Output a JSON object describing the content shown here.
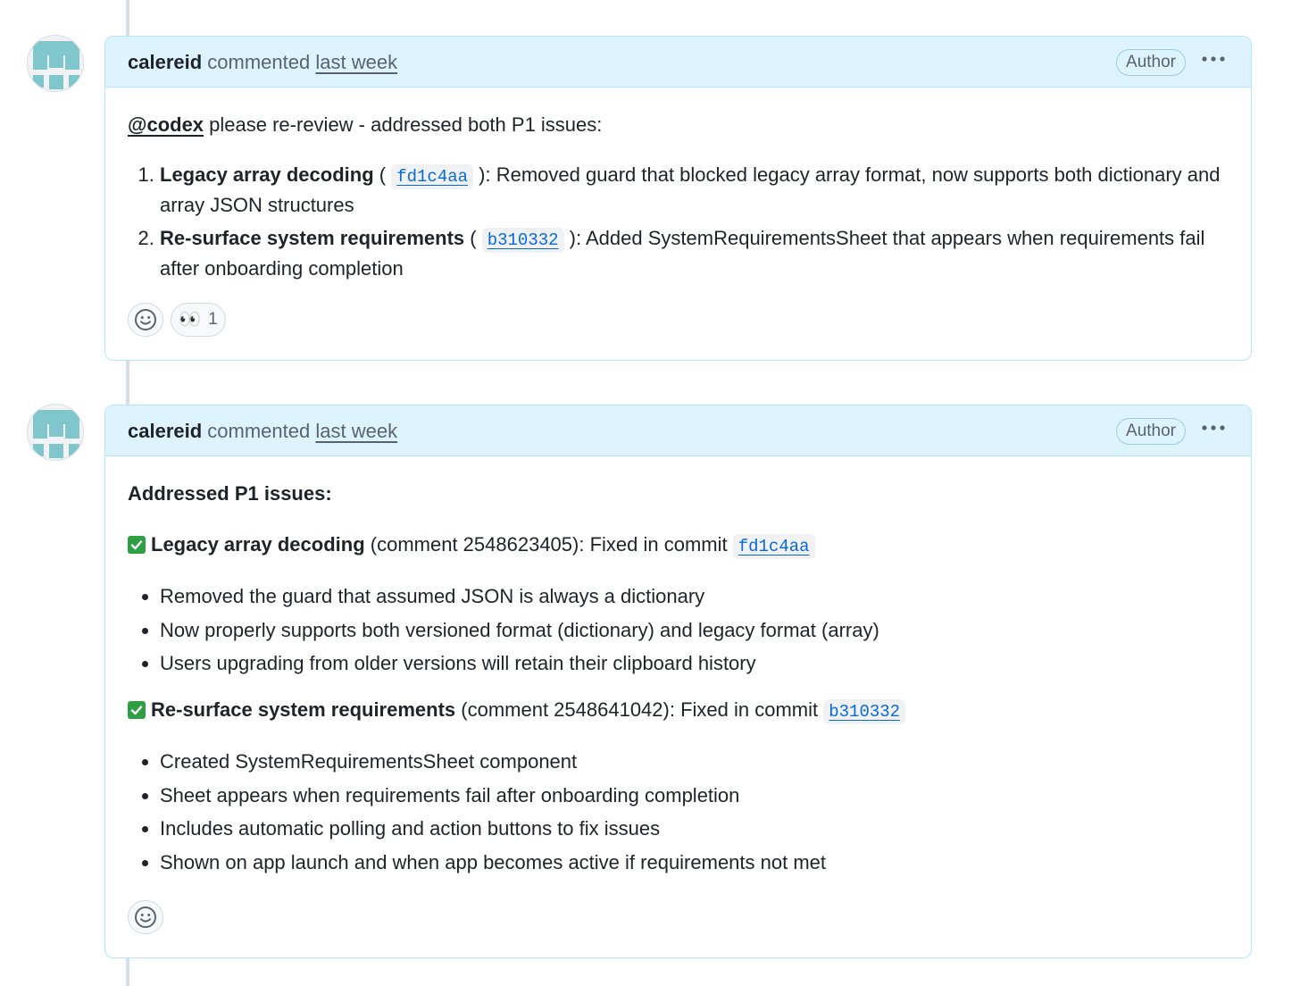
{
  "comments": [
    {
      "author": "calereid",
      "action": "commented",
      "time": "last week",
      "badge": "Author",
      "intro_mention": "@codex",
      "intro_text": " please re-review - addressed both P1 issues:",
      "items": [
        {
          "title": "Legacy array decoding",
          "sha": "fd1c4aa",
          "text": "): Removed guard that blocked legacy array format, now supports both dictionary and array JSON structures"
        },
        {
          "title": "Re-surface system requirements",
          "sha": "b310332",
          "text": "): Added SystemRequirementsSheet that appears when requirements fail after onboarding completion"
        }
      ],
      "reaction": {
        "icon": "eyes-emoji",
        "glyph": "👀",
        "count": "1"
      }
    },
    {
      "author": "calereid",
      "action": "commented",
      "time": "last week",
      "badge": "Author",
      "heading": "Addressed P1 issues:",
      "sections": [
        {
          "title": "Legacy array decoding",
          "meta": " (comment 2548623405): Fixed in commit ",
          "sha": "fd1c4aa",
          "bullets": [
            "Removed the guard that assumed JSON is always a dictionary",
            "Now properly supports both versioned format (dictionary) and legacy format (array)",
            "Users upgrading from older versions will retain their clipboard history"
          ]
        },
        {
          "title": "Re-surface system requirements",
          "meta": " (comment 2548641042): Fixed in commit ",
          "sha": "b310332",
          "bullets": [
            "Created SystemRequirementsSheet component",
            "Sheet appears when requirements fail after onboarding completion",
            "Includes automatic polling and action buttons to fix issues",
            "Shown on app launch and when app becomes active if requirements not met"
          ]
        }
      ]
    }
  ],
  "colors": {
    "header_bg": "#ddf4ff",
    "border": "#b6e3ff",
    "link": "#0969da",
    "check_green": "#2ea043",
    "avatar_teal": "#7fc6cd"
  }
}
